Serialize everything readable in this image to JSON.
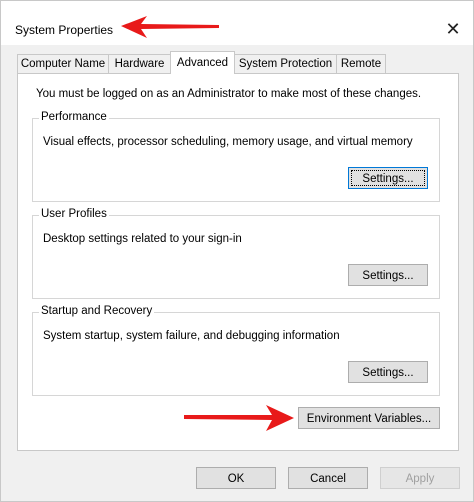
{
  "window": {
    "title": "System Properties",
    "close_glyph": "✕"
  },
  "tabs": [
    {
      "label": "Computer Name",
      "active": false
    },
    {
      "label": "Hardware",
      "active": false
    },
    {
      "label": "Advanced",
      "active": true
    },
    {
      "label": "System Protection",
      "active": false
    },
    {
      "label": "Remote",
      "active": false
    }
  ],
  "advanced": {
    "admin_note": "You must be logged on as an Administrator to make most of these changes.",
    "performance": {
      "label": "Performance",
      "description": "Visual effects, processor scheduling, memory usage, and virtual memory",
      "button": "Settings..."
    },
    "user_profiles": {
      "label": "User Profiles",
      "description": "Desktop settings related to your sign-in",
      "button": "Settings..."
    },
    "startup_recovery": {
      "label": "Startup and Recovery",
      "description": "System startup, system failure, and debugging information",
      "button": "Settings..."
    },
    "env_button": "Environment Variables..."
  },
  "footer": {
    "ok": "OK",
    "cancel": "Cancel",
    "apply": "Apply"
  },
  "annotations": {
    "arrow_color": "#e81a1a"
  }
}
